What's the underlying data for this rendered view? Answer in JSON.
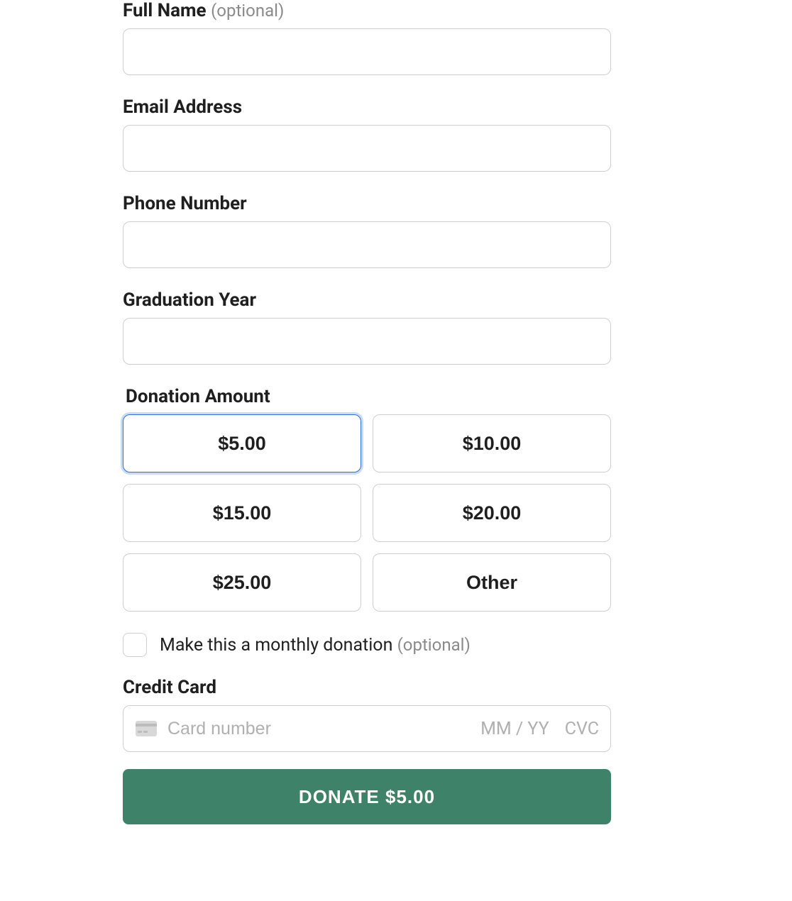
{
  "fields": {
    "full_name": {
      "label": "Full Name",
      "hint": "(optional)",
      "value": ""
    },
    "email": {
      "label": "Email Address",
      "value": ""
    },
    "phone": {
      "label": "Phone Number",
      "value": ""
    },
    "grad_year": {
      "label": "Graduation Year",
      "value": ""
    }
  },
  "donation": {
    "label": "Donation Amount",
    "amounts": [
      "$5.00",
      "$10.00",
      "$15.00",
      "$20.00",
      "$25.00",
      "Other"
    ],
    "selected_index": 0
  },
  "monthly": {
    "label": "Make this a monthly donation",
    "hint": "(optional)",
    "checked": false
  },
  "credit_card": {
    "label": "Credit Card",
    "placeholder": "Card number",
    "exp_placeholder": "MM / YY",
    "cvc_placeholder": "CVC"
  },
  "submit": {
    "label": "DONATE $5.00"
  }
}
